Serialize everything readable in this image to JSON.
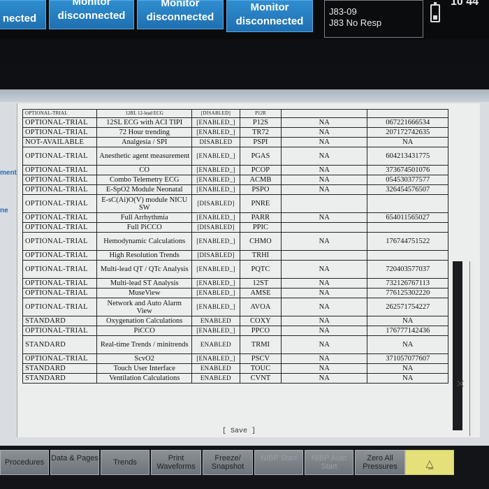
{
  "header": {
    "tiles": [
      {
        "line1": "",
        "line2": "nected"
      },
      {
        "line1": "Monitor",
        "line2": "disconnected"
      },
      {
        "line1": "Monitor",
        "line2": "disconnected"
      },
      {
        "line1": "Monitor",
        "line2": "disconnected"
      }
    ],
    "status_line1": "J83-09",
    "status_line2": "J83 No Resp",
    "clock": "10 44"
  },
  "side_labels": [
    "ment",
    "ne"
  ],
  "options_table": {
    "top_partial": [
      "OPTIONAL-TRIAL",
      "12RL 12-lead ECG",
      "[DISABLED]",
      "P12R",
      "",
      ""
    ],
    "rows": [
      [
        "OPTIONAL-TRIAL",
        "12SL ECG with ACI TIPI",
        "[ENABLED_]",
        "P12S",
        "NA",
        "067221666534"
      ],
      [
        "OPTIONAL-TRIAL",
        "72 Hour trending",
        "[ENABLED_]",
        "TR72",
        "NA",
        "207172742635"
      ],
      [
        "NOT-AVAILABLE",
        "Analgesia / SPI",
        "DISABLED",
        "PSPI",
        "NA",
        "NA"
      ],
      [
        "OPTIONAL-TRIAL",
        "Anesthetic agent measurement",
        "[ENABLED_]",
        "PGAS",
        "NA",
        "604213431775"
      ],
      [
        "OPTIONAL-TRIAL",
        "CO",
        "[ENABLED_]",
        "PCOP",
        "NA",
        "373674501076"
      ],
      [
        "OPTIONAL-TRIAL",
        "Combo Telemetry ECG",
        "[ENABLED_]",
        "ACMB",
        "NA",
        "054530377577"
      ],
      [
        "OPTIONAL-TRIAL",
        "E-SpO2 Module Neonatal",
        "[ENABLED_]",
        "PSPO",
        "NA",
        "326454576507"
      ],
      [
        "OPTIONAL-TRIAL",
        "E-sC(Ai)O(V) module NICU SW",
        "[DISABLED]",
        "PNRE",
        "",
        ""
      ],
      [
        "OPTIONAL-TRIAL",
        "Full Arrhythmia",
        "[ENABLED_]",
        "PARR",
        "NA",
        "654011565027"
      ],
      [
        "OPTIONAL-TRIAL",
        "Full PiCCO",
        "[DISABLED]",
        "PPIC",
        "",
        ""
      ],
      [
        "OPTIONAL-TRIAL",
        "Hemodynamic Calculations",
        "[ENABLED_]",
        "CHMO",
        "NA",
        "176744751522"
      ],
      [
        "OPTIONAL-TRIAL",
        "High Resolution Trends",
        "[DISABLED]",
        "TRHI",
        "",
        ""
      ],
      [
        "OPTIONAL-TRIAL",
        "Multi-lead QT / QTc Analysis",
        "[ENABLED_]",
        "PQTC",
        "NA",
        "720403577037"
      ],
      [
        "OPTIONAL-TRIAL",
        "Multi-lead ST Analysis",
        "[ENABLED_]",
        "12ST",
        "NA",
        "732126767113"
      ],
      [
        "OPTIONAL-TRIAL",
        "MuseView",
        "[ENABLED_]",
        "AMSE",
        "NA",
        "776125302220"
      ],
      [
        "OPTIONAL-TRIAL",
        "Network and Auto Alarm View",
        "[ENABLED_]",
        "AVOA",
        "NA",
        "262571754227"
      ],
      [
        "STANDARD",
        "Oxygenation Calculations",
        "ENABLED",
        "COXY",
        "NA",
        "NA"
      ],
      [
        "OPTIONAL-TRIAL",
        "PiCCO",
        "[ENABLED_]",
        "PPCO",
        "NA",
        "176777142436"
      ],
      [
        "STANDARD",
        "Real-time Trends / minitrends",
        "ENABLED",
        "TRMI",
        "NA",
        "NA"
      ],
      [
        "OPTIONAL-TRIAL",
        "ScvO2",
        "[ENABLED_]",
        "PSCV",
        "NA",
        "371057077607"
      ],
      [
        "STANDARD",
        "Touch User Interface",
        "ENABLED",
        "TOUC",
        "NA",
        "NA"
      ],
      [
        "STANDARD",
        "Ventilation Calculations",
        "ENABLED",
        "CVNT",
        "NA",
        "NA"
      ]
    ],
    "save_label": "[ Save ]"
  },
  "softkeys": [
    {
      "label": "Procedures",
      "dim": false
    },
    {
      "label": "Data & Pages",
      "dim": false
    },
    {
      "label": "Trends",
      "dim": false
    },
    {
      "label": "Print Waveforms",
      "dim": false
    },
    {
      "label": "Freeze/ Snapshot",
      "dim": false
    },
    {
      "label": "NIBP Start",
      "dim": true
    },
    {
      "label": "NIBP Auto Start",
      "dim": true
    },
    {
      "label": "Zero All Pressures",
      "dim": false
    }
  ],
  "alarm_icon": "alarm-silence-icon",
  "colors": {
    "tile_blue": "#1f6fb0",
    "alarm_yellow": "#e6e07a",
    "side_label_blue": "#2a6bb5"
  }
}
